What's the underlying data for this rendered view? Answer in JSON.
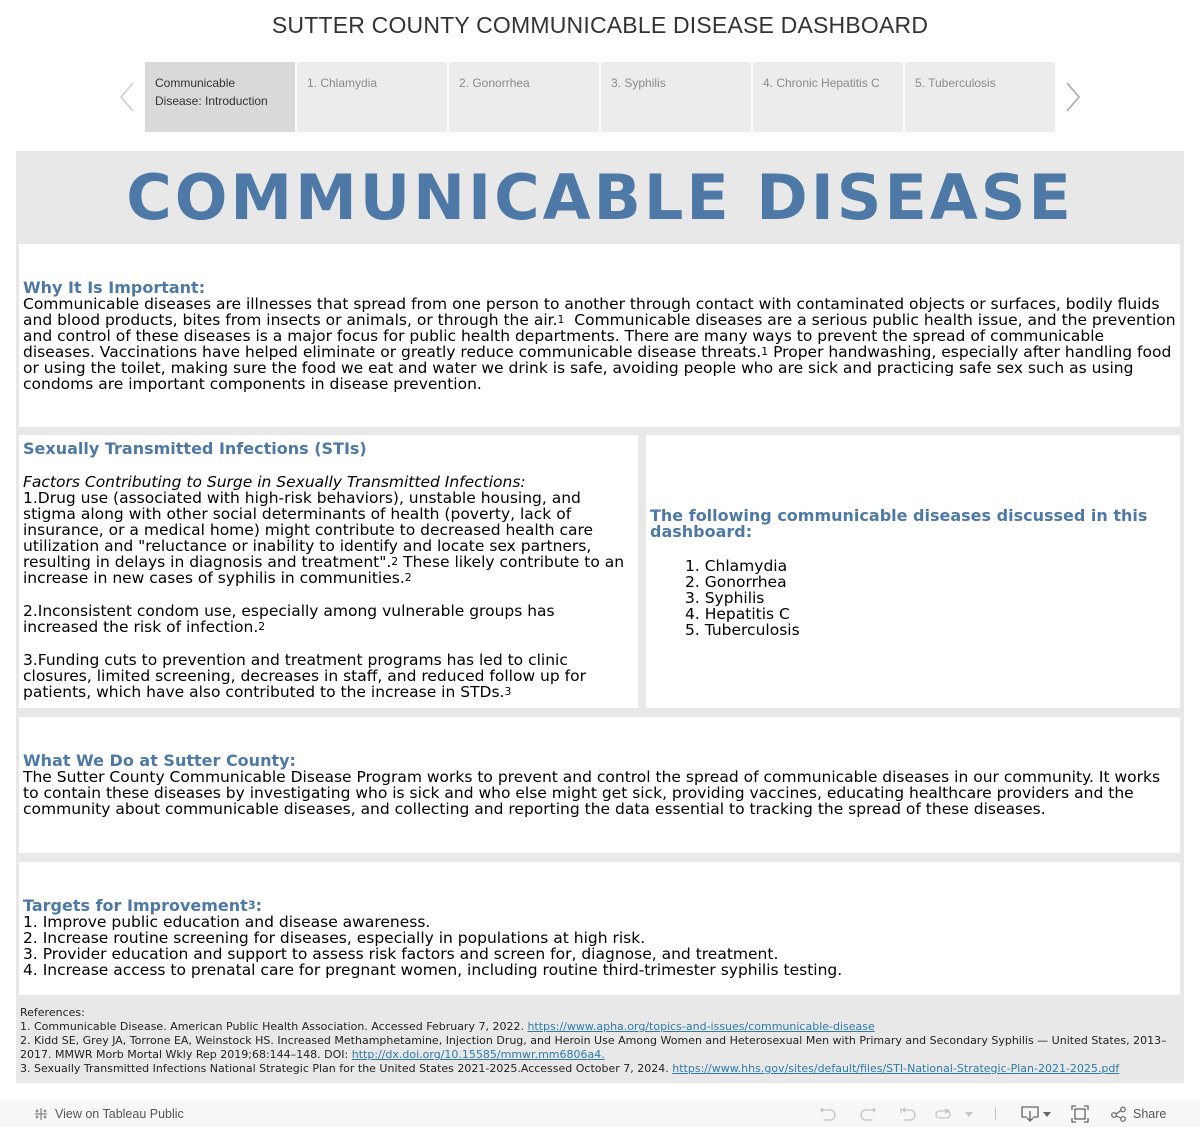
{
  "dashboard_title": "SUTTER COUNTY COMMUNICABLE DISEASE DASHBOARD",
  "tabs": [
    {
      "label": "Communicable Disease: Introduction",
      "active": true
    },
    {
      "label": "1. Chlamydia",
      "active": false
    },
    {
      "label": "2. Gonorrhea",
      "active": false
    },
    {
      "label": "3. Syphilis",
      "active": false
    },
    {
      "label": "4. Chronic Hepatitis C",
      "active": false
    },
    {
      "label": "5. Tuberculosis",
      "active": false
    }
  ],
  "tab_nav": {
    "prev_icon": "chevron-left-icon",
    "next_icon": "chevron-right-icon"
  },
  "banner": "COMMUNICABLE DISEASE",
  "colors": {
    "accent": "#4e79a7",
    "panel_bg": "#ffffff",
    "canvas_bg": "#e8e8e8",
    "link": "#2f7ba8"
  },
  "why": {
    "heading": "Why It Is Important:",
    "text_1": "Communicable diseases are illnesses that spread from one person to another through contact with contaminated objects or surfaces, bodily fluids and blood products, bites from insects or animals, or through the air.",
    "sup_1": "1",
    "text_2": "  Communicable diseases are a serious public health issue, and the prevention and control of these diseases is a major focus for public health departments. There are many ways to prevent the spread of communicable diseases. Vaccinations have helped eliminate or greatly reduce communicable disease threats.",
    "sup_2": "1",
    "text_3": " Proper handwashing, especially after handling food or using the toilet, making sure the food we eat and water we drink is safe, avoiding people who are sick and practicing safe sex such as using condoms are important components in disease prevention."
  },
  "sti": {
    "heading": "Sexually Transmitted Infections (STIs)",
    "subheading": "Factors Contributing to Surge in Sexually Transmitted Infections:",
    "factor_1a": "1.Drug use (associated with high-risk behaviors), unstable housing, and stigma along with other social determinants of health (poverty, lack of insurance, or a medical home) might contribute to decreased health care utilization and \"reluctance or inability to identify and locate sex partners, resulting in delays in diagnosis and treatment\".",
    "factor_1_sup_a": "2",
    "factor_1b": " These likely contribute to an increase in new cases of syphilis in communities.",
    "factor_1_sup_b": "2",
    "factor_2": "2.Inconsistent condom use, especially among vulnerable groups has increased the risk of infection.",
    "factor_2_sup": "2",
    "factor_3": "3.Funding cuts to prevention and treatment programs has led to clinic closures, limited screening, decreases in staff, and reduced follow up for patients, which have also contributed to the increase in STDs.",
    "factor_3_sup": "3"
  },
  "diseases": {
    "heading": "The following communicable diseases discussed in this dashboard:",
    "items": [
      "1. Chlamydia",
      "2. Gonorrhea",
      "3. Syphilis",
      "4. Hepatitis C",
      "5. Tuberculosis"
    ]
  },
  "what": {
    "heading": "What We Do at Sutter County:",
    "text": "The Sutter County Communicable Disease Program works to prevent and control the spread of communicable diseases in our community. It works to contain these diseases by investigating who is sick and who else might get sick, providing vaccines, educating healthcare providers and the community about communicable diseases, and collecting and reporting the data essential to tracking the spread of these diseases."
  },
  "targets": {
    "heading": "Targets for Improvement",
    "heading_sup": "3",
    "heading_suffix": ":",
    "items": [
      "1. Improve public education and disease awareness.",
      "2. Increase routine screening for diseases, especially in populations at high risk.",
      "3. Provider education and support to assess risk factors and screen for, diagnose, and treatment.",
      "4. Increase access to prenatal care for pregnant women, including routine third-trimester syphilis testing."
    ]
  },
  "references": {
    "heading": "References:",
    "items": [
      {
        "text": "1. Communicable Disease. American Public Health Association. Accessed February 7, 2022. ",
        "link": "https://www.apha.org/topics-and-issues/communicable-disease"
      },
      {
        "text": "2. Kidd SE, Grey JA, Torrone EA, Weinstock HS. Increased Methamphetamine, Injection Drug, and Heroin Use Among Women and Heterosexual Men with Primary and Secondary Syphilis — United States, 2013–2017. MMWR Morb Mortal Wkly Rep 2019;68:144–148. DOI: ",
        "link": "http://dx.doi.org/10.15585/mmwr.mm6806a4."
      },
      {
        "text": "3. Sexually Transmitted Infections National Strategic Plan for the United States 2021-2025.Accessed October 7, 2024. ",
        "link": "https://www.hhs.gov/sites/default/files/STI-National-Strategic-Plan-2021-2025.pdf"
      }
    ]
  },
  "toolbar": {
    "view_on_tableau": "View on Tableau Public",
    "share": "Share",
    "icons": [
      "tableau-logo-icon",
      "undo-icon",
      "redo-icon",
      "revert-icon",
      "refresh-icon",
      "dropdown-icon",
      "download-icon",
      "fullscreen-icon",
      "share-icon"
    ]
  }
}
